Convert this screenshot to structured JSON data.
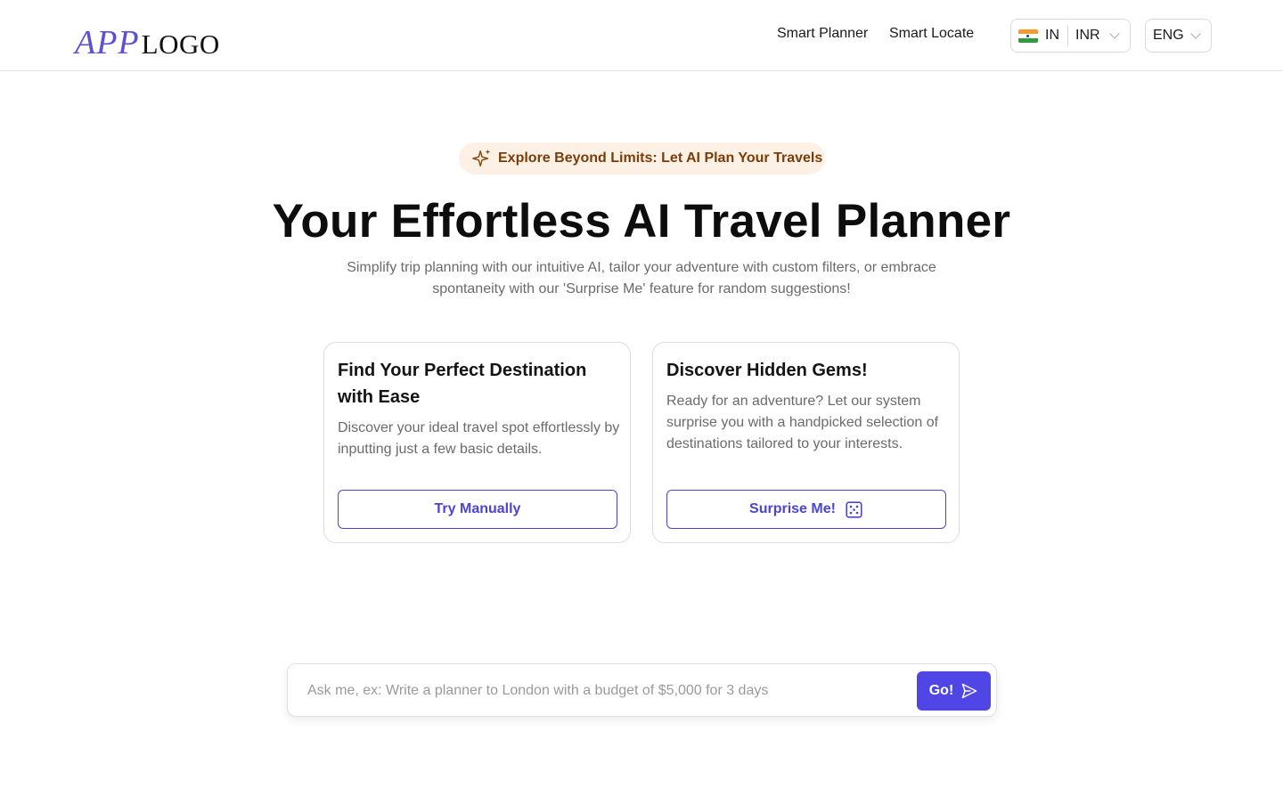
{
  "header": {
    "logo_app": "APP",
    "logo_text": "LOGO",
    "nav": [
      {
        "label": "Smart Planner"
      },
      {
        "label": "Smart Locate"
      }
    ],
    "locale": {
      "flag_icon": "india-flag-icon",
      "country": "IN",
      "currency": "INR"
    },
    "language": "ENG"
  },
  "hero": {
    "badge_icon": "sparkle-icon",
    "badge": "Explore Beyond Limits: Let AI Plan Your Travels",
    "title": "Your Effortless AI Travel Planner",
    "subtitle": "Simplify trip planning with our intuitive AI, tailor your adventure with custom filters, or embrace spontaneity with our 'Surprise Me' feature for random suggestions!"
  },
  "cards": [
    {
      "title": "Find Your Perfect Destination with Ease",
      "description": "Discover your ideal travel spot effortlessly by inputting just a few basic details.",
      "button": "Try Manually"
    },
    {
      "title": "Discover Hidden Gems!",
      "description": "Ready for an adventure? Let our system surprise you with a handpicked selection of destinations tailored to your interests.",
      "button": "Surprise Me!",
      "button_icon": "dice-icon"
    }
  ],
  "prompt": {
    "value": "",
    "placeholder": "Ask me, ex: Write a planner to London with a budget of $5,000 for 3 days",
    "button": "Go!",
    "button_icon": "send-icon"
  },
  "colors": {
    "accent": "#4f46e5",
    "logo_accent": "#5b50d6",
    "badge_bg": "#fdf1e6",
    "badge_text": "#7a3d0a"
  }
}
